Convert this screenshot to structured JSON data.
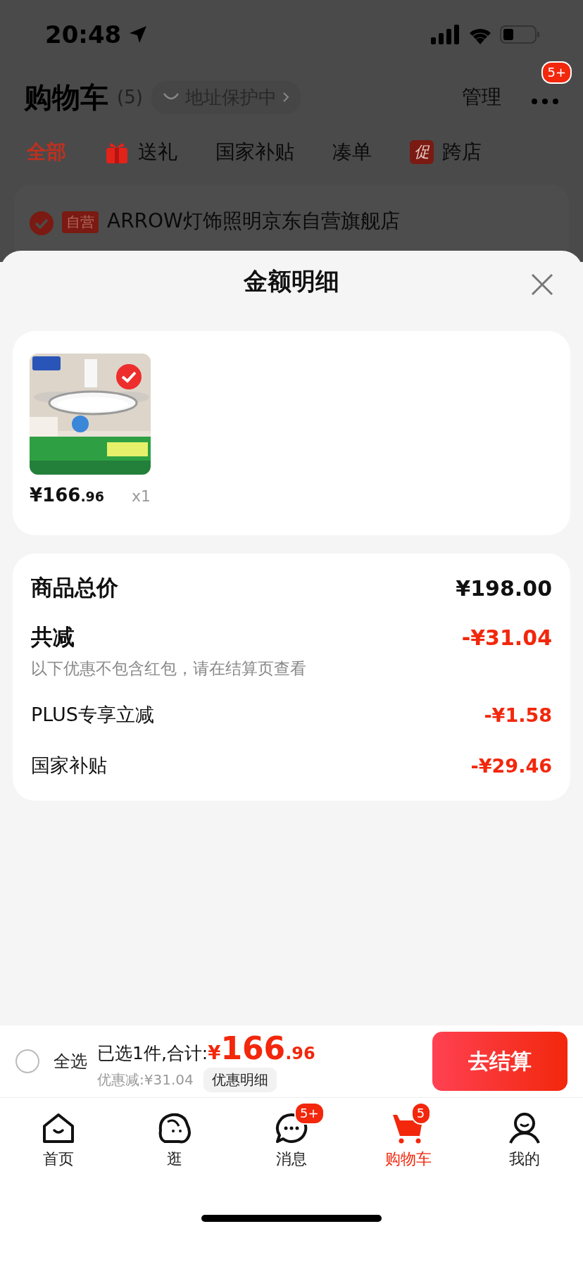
{
  "status_bar": {
    "time": "20:48"
  },
  "header": {
    "title": "购物车",
    "count": "(5)",
    "address_chip": "地址保护中",
    "manage": "管理",
    "more_badge": "5+"
  },
  "filter_tabs": [
    {
      "label": "全部",
      "selected": true,
      "kind": "text"
    },
    {
      "label": "送礼",
      "selected": false,
      "kind": "gift"
    },
    {
      "label": "国家补贴",
      "selected": false,
      "kind": "text"
    },
    {
      "label": "凑单",
      "selected": false,
      "kind": "text"
    },
    {
      "label": "跨店",
      "selected": false,
      "kind": "promo",
      "badge": "促"
    }
  ],
  "store": {
    "checked": true,
    "tag": "自营",
    "name": "ARROW灯饰照明京东自营旗舰店"
  },
  "sheet": {
    "title": "金额明细",
    "items": [
      {
        "selected": true,
        "price_main": "¥166",
        "price_decimal": ".96",
        "quantity": "x1"
      }
    ],
    "summary": [
      {
        "kind": "total",
        "label": "商品总价",
        "amount": "¥198.00"
      },
      {
        "kind": "discount_total",
        "label": "共减",
        "amount": "-¥31.04",
        "note": "以下优惠不包含红包，请在结算页查看"
      },
      {
        "kind": "discount",
        "label": "PLUS专享立减",
        "amount": "-¥1.58"
      },
      {
        "kind": "discount",
        "label": "国家补贴",
        "amount": "-¥29.46"
      }
    ]
  },
  "checkout_bar": {
    "select_all": {
      "label": "全选",
      "checked": false
    },
    "selected_text": "已选1件,合计:",
    "currency": "¥",
    "total_main": "166",
    "total_decimal": ".96",
    "discount_text": "优惠减:¥31.04",
    "detail_button": "优惠明细",
    "checkout_button": "去结算"
  },
  "tab_bar": [
    {
      "label": "首页",
      "kind": "home",
      "selected": false
    },
    {
      "label": "逛",
      "kind": "face",
      "selected": false
    },
    {
      "label": "消息",
      "kind": "chat",
      "selected": false,
      "badge": "5+"
    },
    {
      "label": "购物车",
      "kind": "cart",
      "selected": true,
      "badge": "5"
    },
    {
      "label": "我的",
      "kind": "person",
      "selected": false
    }
  ]
}
